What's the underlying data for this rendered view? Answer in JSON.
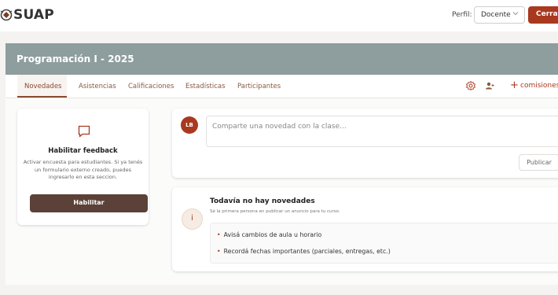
{
  "app": {
    "logo_text": "SUAP"
  },
  "header": {
    "perfil_label": "Perfil:",
    "perfil_value": "Docente",
    "logout_label": "Cerrar"
  },
  "course": {
    "title": "Programación I - 2025"
  },
  "tabs": [
    {
      "label": "Novedades",
      "active": true
    },
    {
      "label": "Asistencias"
    },
    {
      "label": "Calificaciones"
    },
    {
      "label": "Estadísticas"
    },
    {
      "label": "Participantes"
    }
  ],
  "toolbar": {
    "comisiones_label": "comisiones"
  },
  "feedback": {
    "title": "Habilitar feedback",
    "description": "Activar encuesta para estudiantes. Si ya tenés un formulario externo creado, puedes ingresarlo en esta seccion.",
    "button_label": "Habilitar"
  },
  "compose": {
    "avatar_initials": "LB",
    "placeholder": "Comparte una novedad con la clase...",
    "publish_label": "Publicar"
  },
  "empty_state": {
    "icon_letter": "i",
    "title": "Todavía no hay novedades",
    "subtitle": "Sé la primera persona en publicar un anuncio para tu curso.",
    "tips": [
      "Avisá cambios de aula u horario",
      "Recordá fechas importantes (parciales, entregas, etc.)"
    ]
  },
  "colors": {
    "accent": "#a8391f",
    "header_band": "#8e9d9d",
    "button_dark": "#5b4137",
    "tab_text": "#8a5a44"
  },
  "icons": [
    "logo-mark-icon",
    "chevron-down-icon",
    "settings-icon",
    "add-user-icon",
    "plus-icon",
    "chat-icon",
    "info-icon"
  ]
}
